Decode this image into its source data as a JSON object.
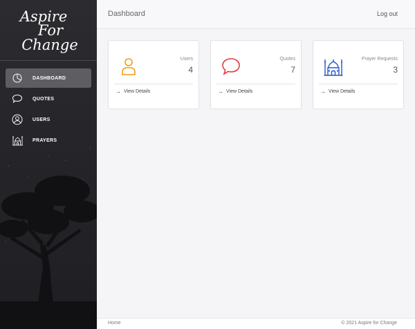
{
  "brand": {
    "line1": "Aspire",
    "line2": "For",
    "line3": "Change"
  },
  "sidebar": {
    "items": [
      {
        "label": "DASHBOARD",
        "icon": "pie-chart-icon",
        "active": true
      },
      {
        "label": "QUOTES",
        "icon": "speech-bubble-icon",
        "active": false
      },
      {
        "label": "USERS",
        "icon": "user-circle-icon",
        "active": false
      },
      {
        "label": "PRAYERS",
        "icon": "mosque-icon",
        "active": false
      }
    ]
  },
  "header": {
    "title": "Dashboard",
    "logout": "Log out"
  },
  "cards": [
    {
      "label": "Users",
      "value": "4",
      "details": "View Details",
      "icon": "user-icon",
      "color": "#f39c12"
    },
    {
      "label": "Quotes",
      "value": "7",
      "details": "View Details",
      "icon": "speech-bubble-icon",
      "color": "#e23a3a"
    },
    {
      "label": "Prayer Requests",
      "value": "3",
      "details": "View Details",
      "icon": "mosque-icon",
      "color": "#2255cc"
    }
  ],
  "footer": {
    "home": "Home",
    "copyright": "© 2021 Aspire for Change"
  },
  "colors": {
    "sidebar_bg": "#26262a",
    "active_item": "#5e5e62",
    "content_bg": "#f5f5f7"
  }
}
